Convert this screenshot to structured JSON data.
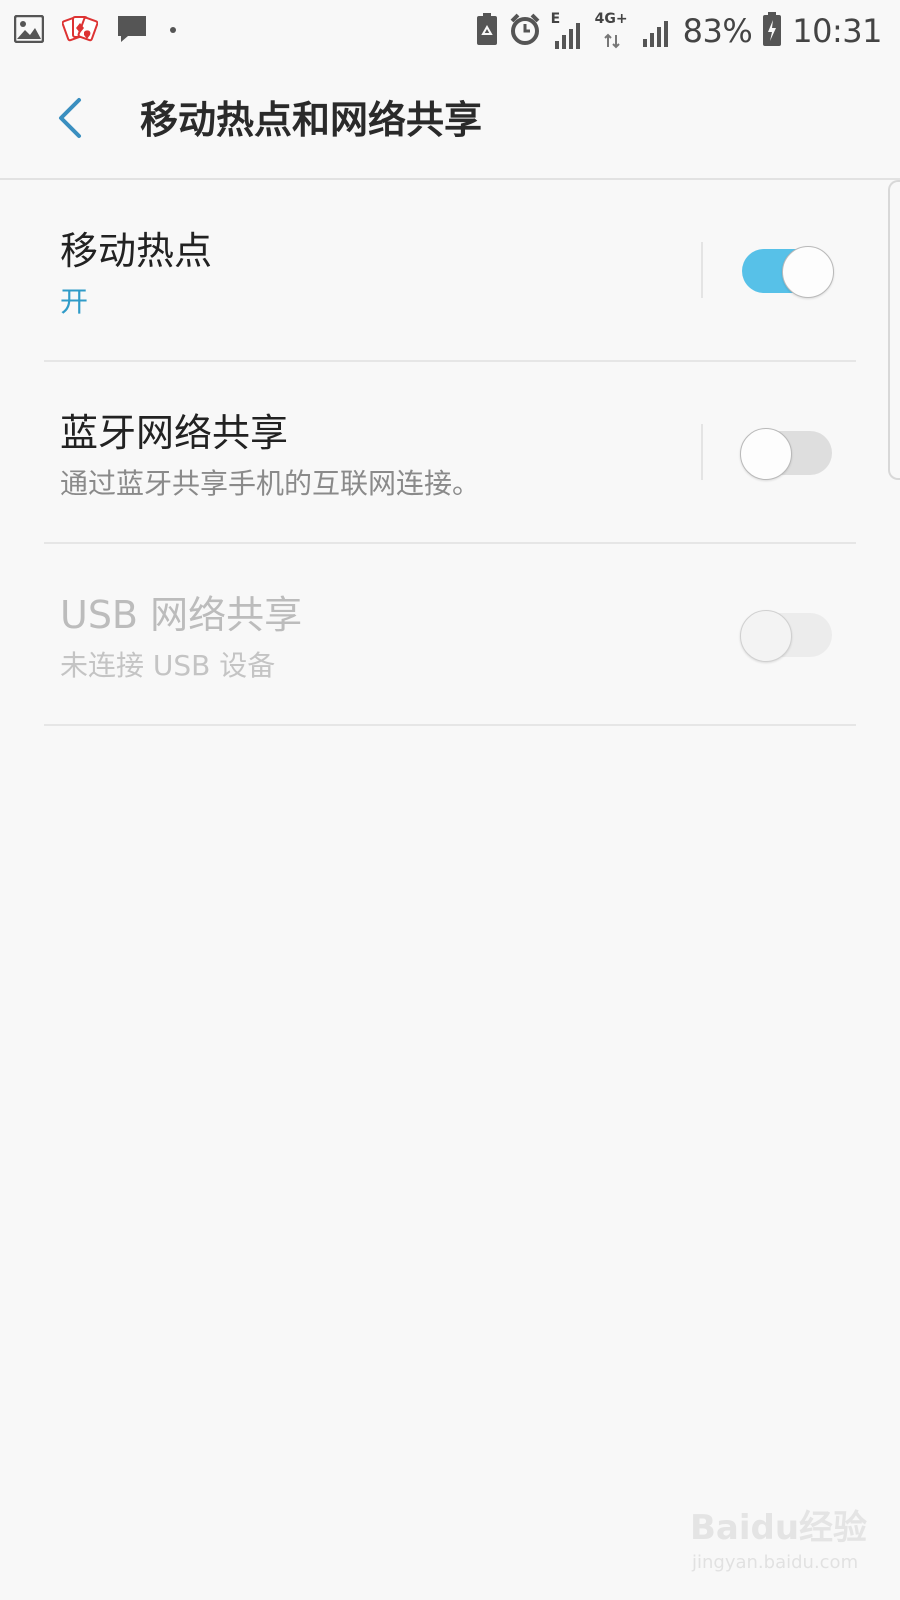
{
  "status_bar": {
    "left_icons": [
      "gallery-icon",
      "cards-app-icon",
      "message-icon",
      "dot-icon"
    ],
    "network_e": "E",
    "network_4g": "4G+",
    "battery": "83%",
    "time": "10:31"
  },
  "header": {
    "title": "移动热点和网络共享"
  },
  "settings": [
    {
      "title": "移动热点",
      "subtitle": "开",
      "state": "on",
      "enabled": true
    },
    {
      "title": "蓝牙网络共享",
      "subtitle": "通过蓝牙共享手机的互联网连接。",
      "state": "off",
      "enabled": true
    },
    {
      "title": "USB 网络共享",
      "subtitle": "未连接 USB 设备",
      "state": "off",
      "enabled": false
    }
  ],
  "watermark": {
    "logo_text": "Baidu经验",
    "url": "jingyan.baidu.com"
  },
  "colors": {
    "accent": "#2f9bc8",
    "toggle_on": "#57c1e8",
    "background": "#f8f8f8"
  }
}
